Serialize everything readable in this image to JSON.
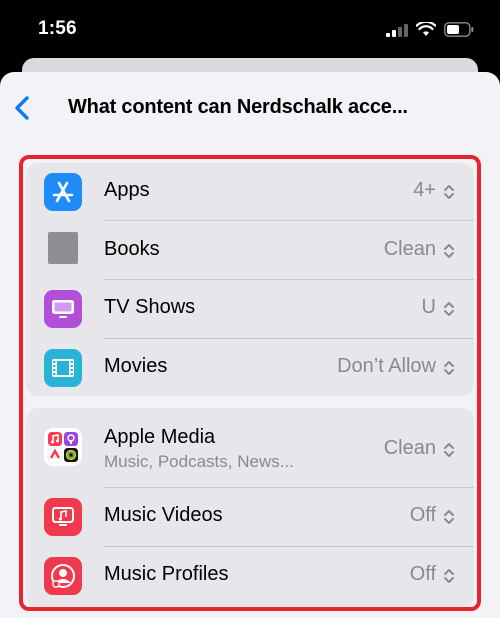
{
  "status_bar": {
    "time": "1:56"
  },
  "nav": {
    "title": "What content can Nerdschalk acce..."
  },
  "groups": [
    {
      "rows": [
        {
          "label": "Apps",
          "value": "4+",
          "icon": "app-store-icon"
        },
        {
          "label": "Books",
          "value": "Clean",
          "icon": "books-icon"
        },
        {
          "label": "TV Shows",
          "value": "U",
          "icon": "tv-icon"
        },
        {
          "label": "Movies",
          "value": "Don’t Allow",
          "icon": "film-icon"
        }
      ]
    },
    {
      "rows": [
        {
          "label": "Apple Media",
          "sublabel": "Music, Podcasts, News...",
          "value": "Clean",
          "icon": "apple-media-apps-icon"
        },
        {
          "label": "Music Videos",
          "value": "Off",
          "icon": "music-video-icon"
        },
        {
          "label": "Music Profiles",
          "value": "Off",
          "icon": "music-profile-icon"
        }
      ]
    }
  ],
  "colors": {
    "accent": "#0a7aff",
    "highlight": "#e5262e",
    "app_store": "#1d8cf8",
    "tv": "#b24fd8",
    "movies": "#29b3d6",
    "music": "#f0394f"
  }
}
